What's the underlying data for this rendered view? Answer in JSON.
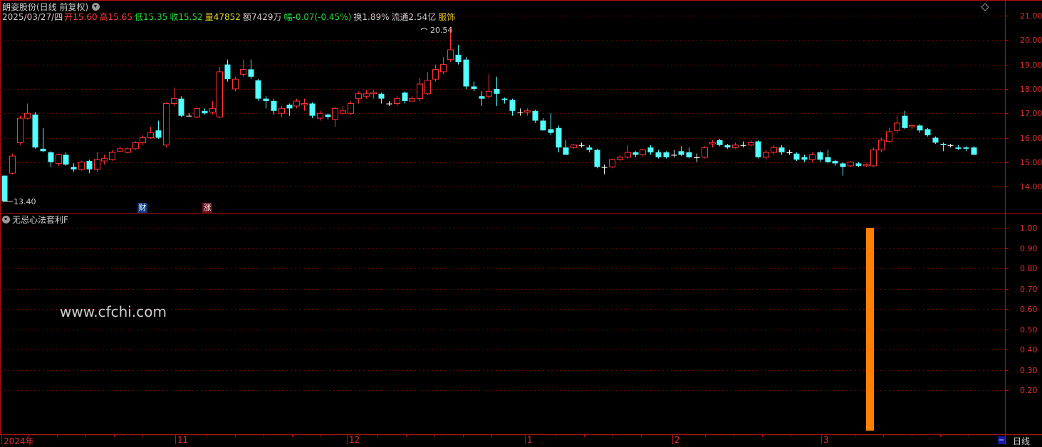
{
  "header": {
    "title": "朗姿股份(日线 前复权)",
    "date": "2025/03/27/四",
    "open_label": "开",
    "open": "15.60",
    "high_label": "高",
    "high": "15.65",
    "low_label": "低",
    "low": "15.35",
    "close_label": "收",
    "close": "15.52",
    "volume_label": "量",
    "volume": "47852",
    "amount_label": "额",
    "amount": "7429万",
    "change_label": "幅",
    "change": "-0.07(-0.45%)",
    "turnover_label": "换",
    "turnover": "1.89%",
    "float_label": "流通",
    "float": "2.54亿",
    "sector": "服饰"
  },
  "price_axis": [
    "21.00",
    "20.00",
    "19.00",
    "18.00",
    "17.00",
    "16.00",
    "15.00",
    "14.00"
  ],
  "annotations": {
    "high_mark": "20.54",
    "low_mark": "13.40"
  },
  "badges": {
    "finance": "财",
    "rise": "涨"
  },
  "indicator": {
    "title": "无忌心法套利F",
    "axis": [
      "1.00",
      "0.90",
      "0.80",
      "0.70",
      "0.60",
      "0.50",
      "0.40",
      "0.30",
      "0.20"
    ],
    "signal_value": 1.0
  },
  "watermark": "www.cfchi.com",
  "time_axis": [
    "2024年",
    "11",
    "12",
    "1",
    "2",
    "3"
  ],
  "period_label": "日线",
  "colors": {
    "up": "#ff3232",
    "down": "#54ffff",
    "doji": "#ffffff",
    "signal": "#ff8000",
    "grid": "#7a0000"
  },
  "chart_data": {
    "type": "candlestick",
    "ylim": [
      13.4,
      21.2
    ],
    "candles": [
      [
        14.45,
        13.4,
        14.45,
        13.4
      ],
      [
        14.55,
        15.25,
        15.35,
        14.5
      ],
      [
        15.8,
        16.8,
        16.9,
        15.7
      ],
      [
        16.8,
        17.0,
        17.4,
        16.75
      ],
      [
        16.95,
        15.6,
        17.05,
        15.55
      ],
      [
        15.55,
        15.45,
        16.4,
        15.4
      ],
      [
        15.4,
        15.0,
        15.45,
        14.8
      ],
      [
        14.95,
        15.3,
        15.35,
        14.85
      ],
      [
        15.3,
        14.9,
        15.4,
        14.85
      ],
      [
        14.8,
        14.7,
        14.95,
        14.6
      ],
      [
        14.7,
        15.0,
        15.05,
        14.65
      ],
      [
        15.05,
        14.7,
        15.1,
        14.55
      ],
      [
        14.7,
        15.1,
        15.4,
        14.6
      ],
      [
        15.05,
        15.15,
        15.3,
        14.9
      ],
      [
        15.1,
        15.4,
        15.5,
        15.05
      ],
      [
        15.45,
        15.55,
        15.65,
        15.4
      ],
      [
        15.4,
        15.55,
        15.6,
        15.35
      ],
      [
        15.55,
        15.8,
        15.85,
        15.5
      ],
      [
        15.8,
        16.0,
        16.1,
        15.7
      ],
      [
        16.0,
        16.2,
        16.45,
        15.95
      ],
      [
        16.3,
        16.0,
        16.7,
        15.95
      ],
      [
        15.7,
        17.4,
        17.45,
        15.6
      ],
      [
        17.4,
        17.6,
        18.05,
        17.3
      ],
      [
        17.6,
        16.9,
        17.7,
        16.85
      ],
      [
        16.9,
        16.9,
        17.0,
        16.9
      ],
      [
        16.85,
        17.2,
        17.25,
        16.8
      ],
      [
        17.1,
        17.0,
        17.2,
        16.95
      ],
      [
        17.05,
        17.2,
        17.5,
        16.95
      ],
      [
        16.85,
        18.7,
        18.9,
        16.8
      ],
      [
        19.0,
        18.4,
        19.2,
        18.3
      ],
      [
        18.0,
        18.4,
        18.5,
        17.9
      ],
      [
        18.6,
        18.8,
        19.2,
        18.5
      ],
      [
        18.8,
        18.5,
        19.2,
        18.4
      ],
      [
        18.35,
        17.6,
        18.4,
        17.5
      ],
      [
        17.6,
        17.5,
        17.7,
        17.2
      ],
      [
        17.5,
        17.1,
        17.6,
        16.95
      ],
      [
        17.0,
        17.2,
        17.3,
        16.85
      ],
      [
        17.35,
        17.2,
        17.4,
        16.9
      ],
      [
        17.3,
        17.5,
        17.6,
        17.2
      ],
      [
        17.35,
        17.4,
        17.6,
        17.1
      ],
      [
        17.4,
        16.9,
        17.45,
        16.8
      ],
      [
        16.8,
        17.0,
        17.1,
        16.7
      ],
      [
        16.95,
        16.85,
        17.0,
        16.75
      ],
      [
        16.75,
        17.2,
        17.25,
        16.45
      ],
      [
        17.0,
        17.1,
        17.3,
        16.95
      ],
      [
        17.0,
        17.4,
        17.5,
        16.95
      ],
      [
        17.6,
        17.8,
        17.9,
        17.4
      ],
      [
        17.7,
        17.8,
        17.95,
        17.6
      ],
      [
        17.8,
        17.85,
        17.95,
        17.6
      ],
      [
        17.8,
        17.6,
        17.85,
        17.4
      ],
      [
        17.4,
        17.4,
        17.5,
        17.3
      ],
      [
        17.4,
        17.6,
        17.7,
        17.3
      ],
      [
        17.85,
        17.5,
        17.9,
        17.4
      ],
      [
        17.5,
        17.6,
        17.7,
        17.5
      ],
      [
        17.6,
        18.2,
        18.45,
        17.5
      ],
      [
        17.8,
        18.35,
        18.7,
        17.75
      ],
      [
        18.4,
        18.8,
        19.0,
        18.3
      ],
      [
        18.7,
        19.0,
        19.3,
        18.6
      ],
      [
        19.2,
        19.6,
        20.54,
        19.1
      ],
      [
        19.4,
        19.1,
        19.8,
        19.0
      ],
      [
        19.2,
        18.1,
        19.3,
        18.0
      ],
      [
        18.1,
        18.0,
        18.3,
        17.9
      ],
      [
        17.7,
        17.6,
        17.9,
        17.3
      ],
      [
        17.7,
        17.9,
        18.6,
        17.6
      ],
      [
        18.0,
        17.8,
        18.5,
        17.3
      ],
      [
        17.6,
        17.55,
        17.65,
        17.4
      ],
      [
        17.55,
        17.1,
        17.6,
        16.9
      ],
      [
        17.05,
        17.05,
        17.2,
        16.9
      ],
      [
        17.05,
        17.1,
        17.2,
        16.9
      ],
      [
        17.1,
        16.7,
        17.15,
        16.6
      ],
      [
        16.7,
        16.3,
        16.8,
        16.3
      ],
      [
        16.35,
        16.2,
        17.0,
        16.1
      ],
      [
        16.4,
        15.6,
        16.5,
        15.4
      ],
      [
        15.6,
        15.3,
        15.9,
        15.3
      ],
      [
        15.6,
        15.7,
        15.75,
        15.55
      ],
      [
        15.7,
        15.7,
        15.8,
        15.6
      ],
      [
        15.6,
        15.5,
        15.7,
        15.4
      ],
      [
        15.5,
        14.8,
        15.55,
        14.75
      ],
      [
        14.8,
        14.8,
        14.9,
        14.5
      ],
      [
        14.8,
        15.1,
        15.15,
        14.75
      ],
      [
        15.1,
        15.2,
        15.3,
        15.05
      ],
      [
        15.2,
        15.4,
        15.7,
        15.15
      ],
      [
        15.4,
        15.3,
        15.45,
        15.2
      ],
      [
        15.3,
        15.5,
        15.55,
        15.25
      ],
      [
        15.6,
        15.4,
        15.7,
        15.3
      ],
      [
        15.4,
        15.2,
        15.5,
        15.15
      ],
      [
        15.4,
        15.2,
        15.45,
        15.15
      ],
      [
        15.3,
        15.3,
        15.5,
        15.2
      ],
      [
        15.45,
        15.3,
        15.65,
        15.25
      ],
      [
        15.4,
        15.2,
        15.6,
        15.15
      ],
      [
        15.2,
        15.2,
        15.35,
        15.0
      ],
      [
        15.2,
        15.6,
        15.65,
        15.15
      ],
      [
        15.75,
        15.8,
        15.9,
        15.6
      ],
      [
        15.9,
        15.7,
        15.95,
        15.65
      ],
      [
        15.7,
        15.6,
        15.75,
        15.55
      ],
      [
        15.6,
        15.7,
        15.8,
        15.55
      ],
      [
        15.7,
        15.7,
        15.85,
        15.6
      ],
      [
        15.7,
        15.8,
        15.9,
        15.65
      ],
      [
        15.85,
        15.2,
        15.9,
        15.15
      ],
      [
        15.2,
        15.4,
        15.5,
        15.1
      ],
      [
        15.4,
        15.6,
        15.7,
        15.3
      ],
      [
        15.6,
        15.4,
        15.7,
        15.3
      ],
      [
        15.4,
        15.4,
        15.5,
        15.3
      ],
      [
        15.35,
        15.1,
        15.4,
        15.05
      ],
      [
        15.2,
        15.1,
        15.3,
        15.0
      ],
      [
        15.1,
        15.3,
        15.4,
        15.0
      ],
      [
        15.4,
        15.1,
        15.45,
        15.0
      ],
      [
        15.2,
        15.0,
        15.5,
        14.95
      ],
      [
        15.05,
        14.95,
        15.1,
        14.85
      ],
      [
        14.95,
        14.8,
        15.0,
        14.45
      ],
      [
        14.85,
        15.0,
        15.05,
        14.8
      ],
      [
        14.95,
        14.85,
        15.0,
        14.8
      ],
      [
        14.85,
        14.9,
        14.95,
        14.8
      ],
      [
        14.85,
        15.5,
        15.6,
        14.8
      ],
      [
        15.5,
        15.9,
        16.0,
        15.4
      ],
      [
        15.85,
        16.25,
        16.4,
        15.8
      ],
      [
        16.3,
        16.6,
        16.9,
        16.2
      ],
      [
        16.9,
        16.4,
        17.1,
        16.35
      ],
      [
        16.45,
        16.5,
        16.55,
        16.35
      ],
      [
        16.5,
        16.3,
        16.55,
        16.2
      ],
      [
        16.35,
        16.1,
        16.4,
        16.05
      ],
      [
        16.0,
        15.8,
        16.05,
        15.75
      ],
      [
        15.75,
        15.7,
        15.8,
        15.45
      ],
      [
        15.7,
        15.7,
        15.75,
        15.6
      ],
      [
        15.6,
        15.55,
        15.7,
        15.5
      ],
      [
        15.6,
        15.55,
        15.65,
        15.45
      ],
      [
        15.6,
        15.3,
        15.65,
        15.3
      ]
    ]
  }
}
